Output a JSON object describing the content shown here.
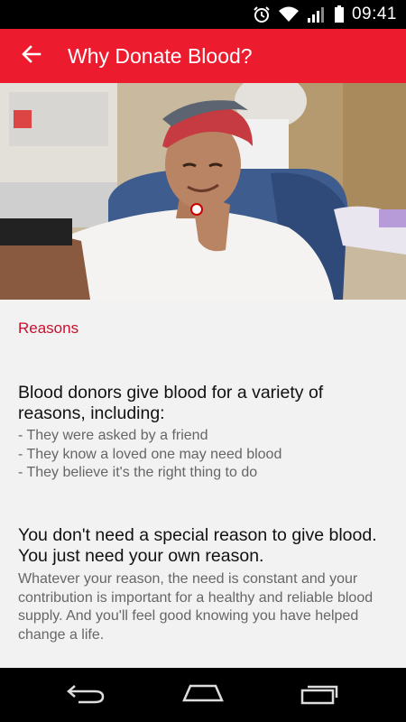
{
  "status_bar": {
    "time": "09:41",
    "icons": [
      "alarm-icon",
      "wifi-icon",
      "signal-icon",
      "battery-icon"
    ]
  },
  "app_bar": {
    "title": "Why Donate Blood?",
    "back_icon": "arrow-left-icon",
    "color": "#ed1b2e"
  },
  "hero": {
    "description_icon": "hero-photo"
  },
  "content": {
    "section_label": "Reasons",
    "intro_heading": "Blood donors give blood for a variety of reasons, including:",
    "reasons": [
      "- They were asked by a friend",
      "- They know a loved one may need blood",
      "- They believe it's the right thing to do"
    ],
    "second_heading": "You don't need a special reason to give blood. You just need your own reason.",
    "paragraph": "Whatever your reason, the need is constant and your contribution is important for a healthy and reliable blood supply. And you'll feel good knowing you have helped change a life."
  },
  "nav_bar": {
    "buttons": [
      "back-nav-icon",
      "home-nav-icon",
      "recents-nav-icon"
    ]
  }
}
